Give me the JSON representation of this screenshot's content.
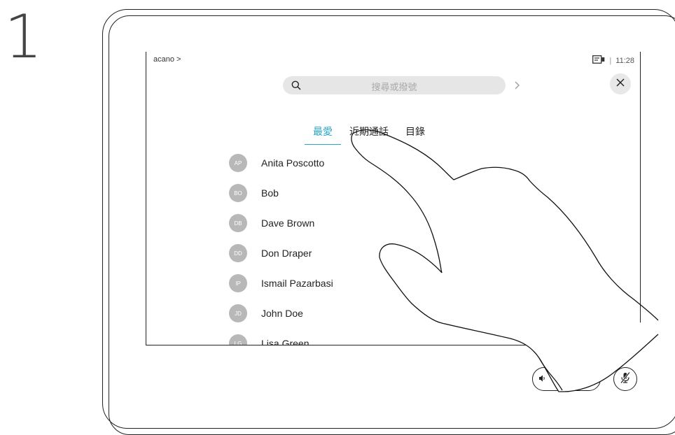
{
  "step": "1",
  "header": {
    "breadcrumb": "acano >",
    "time": "11:28",
    "separator": "|"
  },
  "search": {
    "placeholder": "搜尋或撥號"
  },
  "tabs": [
    {
      "label": "最愛",
      "active": true
    },
    {
      "label": "近期通話",
      "active": false
    },
    {
      "label": "目錄",
      "active": false
    }
  ],
  "contacts": [
    {
      "initials": "AP",
      "name": "Anita Poscotto"
    },
    {
      "initials": "BO",
      "name": "Bob"
    },
    {
      "initials": "DB",
      "name": "Dave Brown"
    },
    {
      "initials": "DD",
      "name": "Don Draper"
    },
    {
      "initials": "IP",
      "name": "Ismail Pazarbasi"
    },
    {
      "initials": "JD",
      "name": "John Doe"
    },
    {
      "initials": "LG",
      "name": "Lisa Green"
    }
  ],
  "colors": {
    "accent": "#2aa6c5",
    "avatar": "#b8b8b8"
  },
  "icons": {
    "search": "search-icon",
    "close": "close-icon",
    "camera": "camera-icon",
    "volume_down": "volume-down-icon",
    "volume_up": "volume-up-icon",
    "mute": "mic-mute-icon"
  }
}
